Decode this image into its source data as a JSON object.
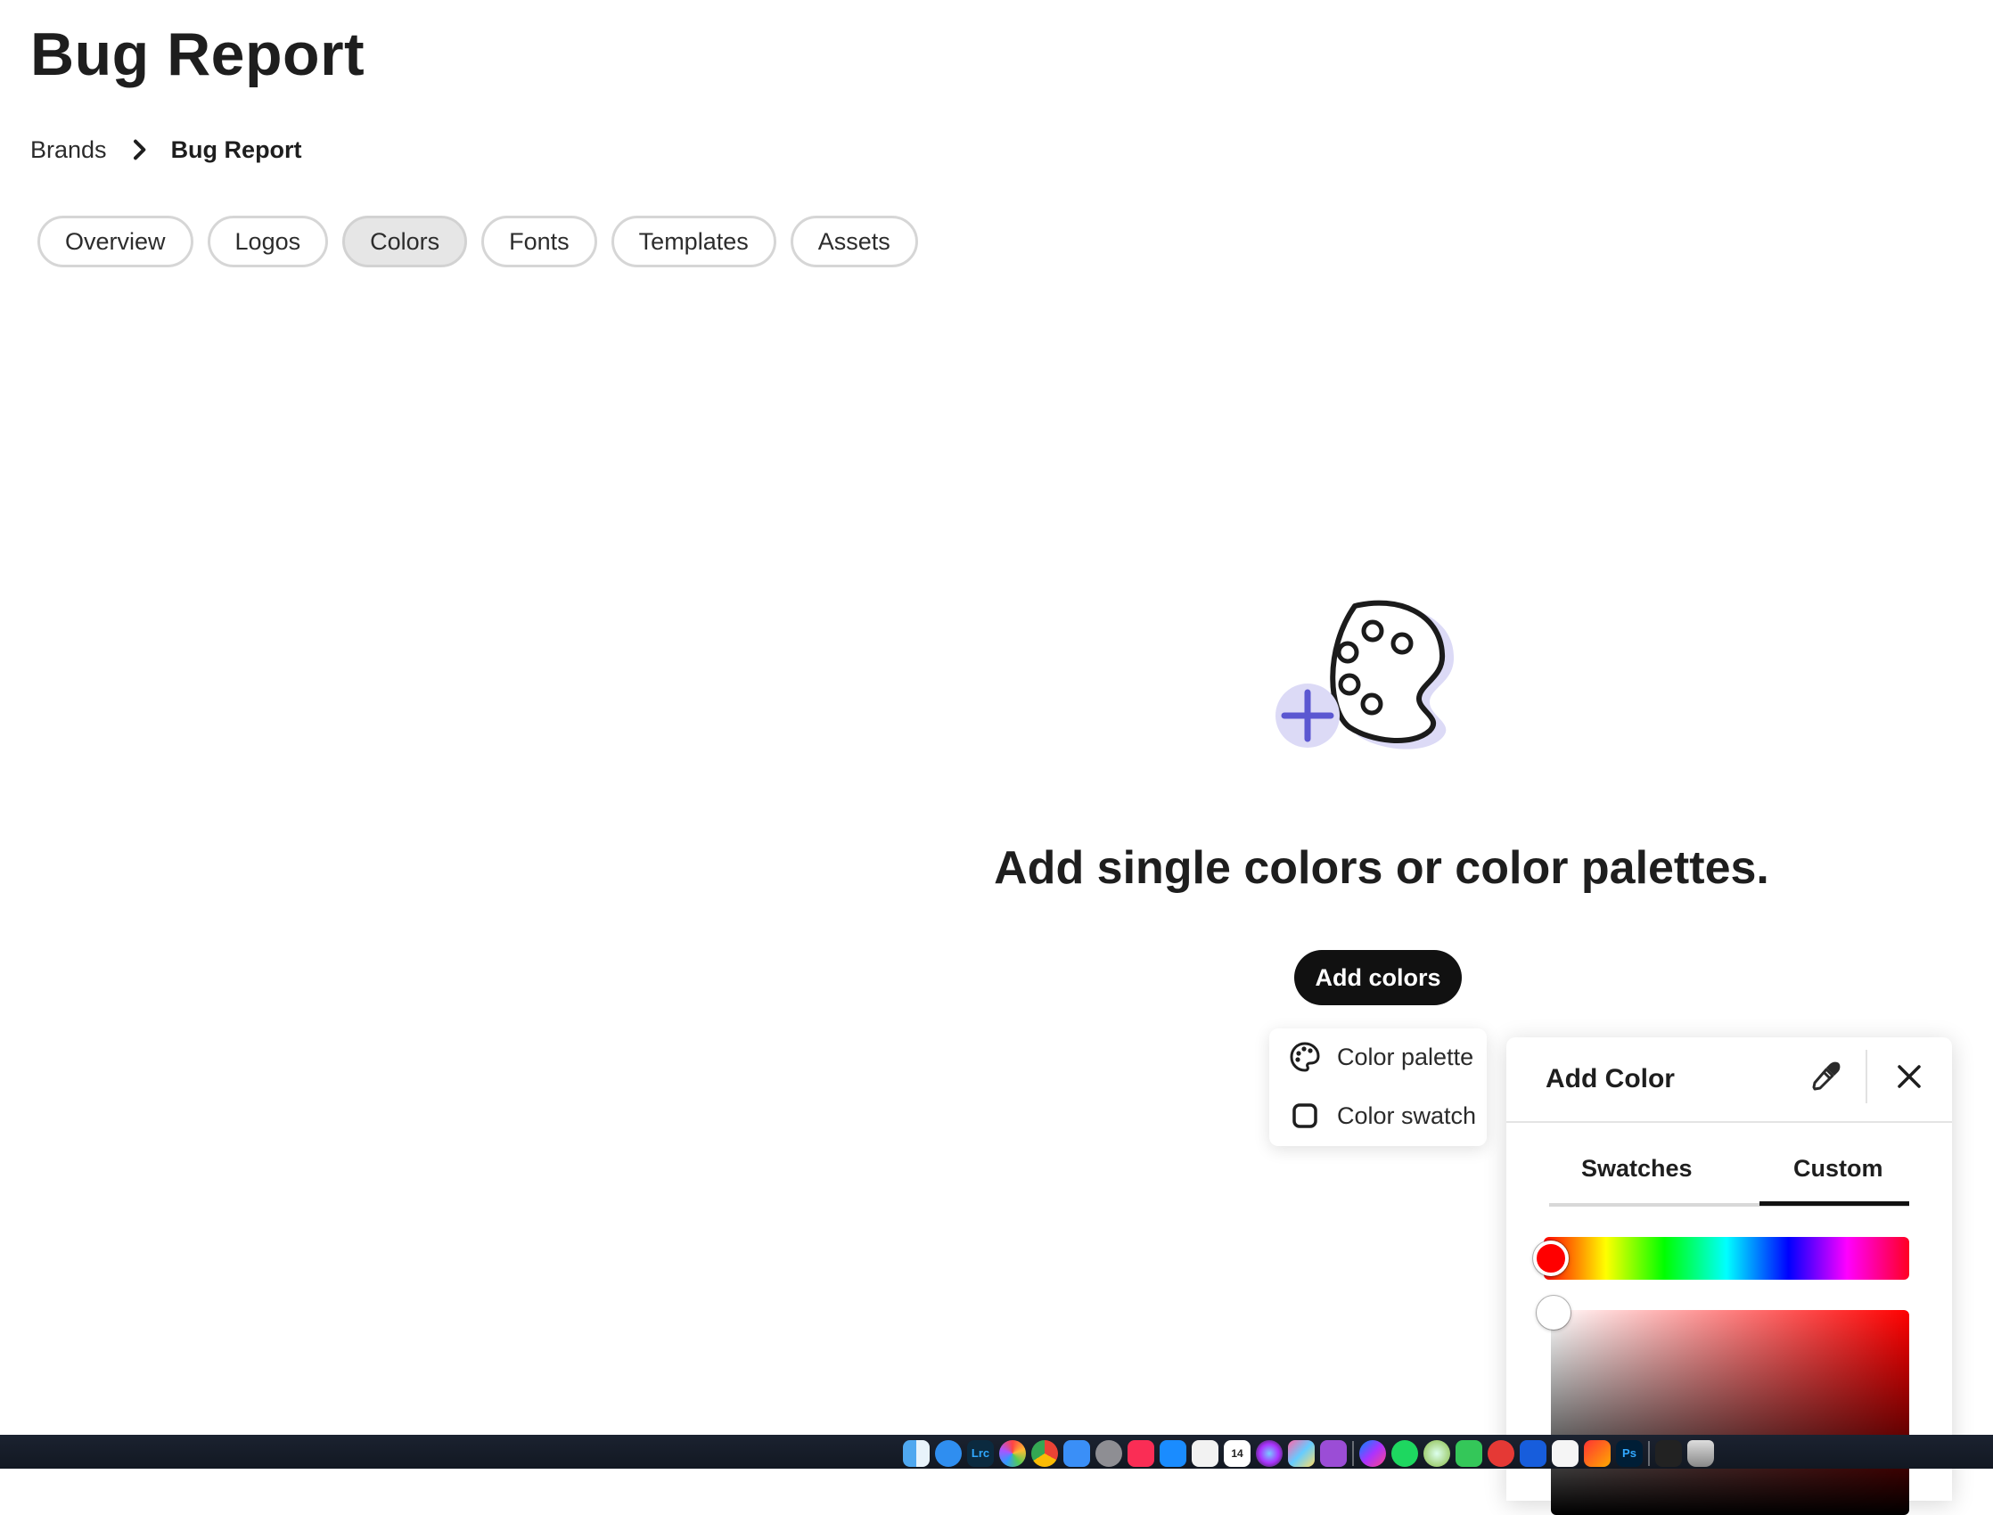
{
  "page": {
    "title": "Bug Report"
  },
  "breadcrumb": {
    "parent": "Brands",
    "current": "Bug Report"
  },
  "tabs": [
    {
      "label": "Overview",
      "active": false
    },
    {
      "label": "Logos",
      "active": false
    },
    {
      "label": "Colors",
      "active": true
    },
    {
      "label": "Fonts",
      "active": false
    },
    {
      "label": "Templates",
      "active": false
    },
    {
      "label": "Assets",
      "active": false
    }
  ],
  "empty_state": {
    "icon": "palette-add-icon",
    "heading": "Add single colors or color palettes.",
    "button_label": "Add colors"
  },
  "add_menu": {
    "items": [
      {
        "label": "Color palette",
        "icon": "palette-icon"
      },
      {
        "label": "Color swatch",
        "icon": "swatch-icon"
      }
    ]
  },
  "add_color_panel": {
    "title": "Add Color",
    "tabs": [
      {
        "label": "Swatches",
        "active": false
      },
      {
        "label": "Custom",
        "active": true
      }
    ],
    "selected_hue_color": "#ff0000"
  },
  "dock": {
    "icons": [
      "finder-icon",
      "safari-icon",
      "lightroom-classic-icon",
      "photos-icon",
      "chrome-icon",
      "mail-icon",
      "settings-icon",
      "music-icon",
      "appstore-icon",
      "files-icon",
      "calendar-icon",
      "siri-icon",
      "launchpad-icon",
      "podcasts-icon",
      "messenger-icon",
      "spotify-icon",
      "circle-app-icon",
      "messages-icon",
      "tasks-icon",
      "bitwarden-icon",
      "news-icon",
      "creative-cloud-icon",
      "photoshop-icon",
      "terminal-icon",
      "trash-icon"
    ],
    "lightroom_label": "Lrc",
    "photoshop_label": "Ps",
    "calendar_day": "14"
  },
  "colors": {
    "accent_purple": "#5b57d1",
    "accent_lavender": "#dcdaf6",
    "primary_button": "#111111"
  }
}
